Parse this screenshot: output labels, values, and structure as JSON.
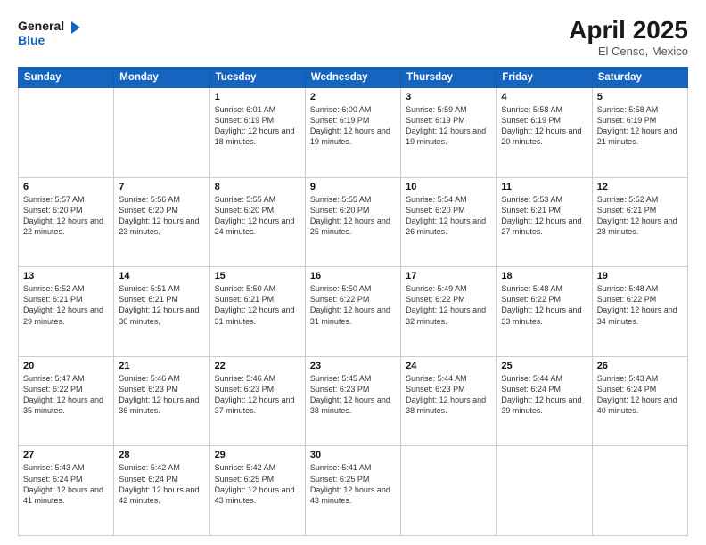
{
  "header": {
    "logo_line1": "General",
    "logo_line2": "Blue",
    "month": "April 2025",
    "location": "El Censo, Mexico"
  },
  "weekdays": [
    "Sunday",
    "Monday",
    "Tuesday",
    "Wednesday",
    "Thursday",
    "Friday",
    "Saturday"
  ],
  "weeks": [
    [
      {
        "day": null,
        "info": null
      },
      {
        "day": null,
        "info": null
      },
      {
        "day": "1",
        "info": "Sunrise: 6:01 AM\nSunset: 6:19 PM\nDaylight: 12 hours and 18 minutes."
      },
      {
        "day": "2",
        "info": "Sunrise: 6:00 AM\nSunset: 6:19 PM\nDaylight: 12 hours and 19 minutes."
      },
      {
        "day": "3",
        "info": "Sunrise: 5:59 AM\nSunset: 6:19 PM\nDaylight: 12 hours and 19 minutes."
      },
      {
        "day": "4",
        "info": "Sunrise: 5:58 AM\nSunset: 6:19 PM\nDaylight: 12 hours and 20 minutes."
      },
      {
        "day": "5",
        "info": "Sunrise: 5:58 AM\nSunset: 6:19 PM\nDaylight: 12 hours and 21 minutes."
      }
    ],
    [
      {
        "day": "6",
        "info": "Sunrise: 5:57 AM\nSunset: 6:20 PM\nDaylight: 12 hours and 22 minutes."
      },
      {
        "day": "7",
        "info": "Sunrise: 5:56 AM\nSunset: 6:20 PM\nDaylight: 12 hours and 23 minutes."
      },
      {
        "day": "8",
        "info": "Sunrise: 5:55 AM\nSunset: 6:20 PM\nDaylight: 12 hours and 24 minutes."
      },
      {
        "day": "9",
        "info": "Sunrise: 5:55 AM\nSunset: 6:20 PM\nDaylight: 12 hours and 25 minutes."
      },
      {
        "day": "10",
        "info": "Sunrise: 5:54 AM\nSunset: 6:20 PM\nDaylight: 12 hours and 26 minutes."
      },
      {
        "day": "11",
        "info": "Sunrise: 5:53 AM\nSunset: 6:21 PM\nDaylight: 12 hours and 27 minutes."
      },
      {
        "day": "12",
        "info": "Sunrise: 5:52 AM\nSunset: 6:21 PM\nDaylight: 12 hours and 28 minutes."
      }
    ],
    [
      {
        "day": "13",
        "info": "Sunrise: 5:52 AM\nSunset: 6:21 PM\nDaylight: 12 hours and 29 minutes."
      },
      {
        "day": "14",
        "info": "Sunrise: 5:51 AM\nSunset: 6:21 PM\nDaylight: 12 hours and 30 minutes."
      },
      {
        "day": "15",
        "info": "Sunrise: 5:50 AM\nSunset: 6:21 PM\nDaylight: 12 hours and 31 minutes."
      },
      {
        "day": "16",
        "info": "Sunrise: 5:50 AM\nSunset: 6:22 PM\nDaylight: 12 hours and 31 minutes."
      },
      {
        "day": "17",
        "info": "Sunrise: 5:49 AM\nSunset: 6:22 PM\nDaylight: 12 hours and 32 minutes."
      },
      {
        "day": "18",
        "info": "Sunrise: 5:48 AM\nSunset: 6:22 PM\nDaylight: 12 hours and 33 minutes."
      },
      {
        "day": "19",
        "info": "Sunrise: 5:48 AM\nSunset: 6:22 PM\nDaylight: 12 hours and 34 minutes."
      }
    ],
    [
      {
        "day": "20",
        "info": "Sunrise: 5:47 AM\nSunset: 6:22 PM\nDaylight: 12 hours and 35 minutes."
      },
      {
        "day": "21",
        "info": "Sunrise: 5:46 AM\nSunset: 6:23 PM\nDaylight: 12 hours and 36 minutes."
      },
      {
        "day": "22",
        "info": "Sunrise: 5:46 AM\nSunset: 6:23 PM\nDaylight: 12 hours and 37 minutes."
      },
      {
        "day": "23",
        "info": "Sunrise: 5:45 AM\nSunset: 6:23 PM\nDaylight: 12 hours and 38 minutes."
      },
      {
        "day": "24",
        "info": "Sunrise: 5:44 AM\nSunset: 6:23 PM\nDaylight: 12 hours and 38 minutes."
      },
      {
        "day": "25",
        "info": "Sunrise: 5:44 AM\nSunset: 6:24 PM\nDaylight: 12 hours and 39 minutes."
      },
      {
        "day": "26",
        "info": "Sunrise: 5:43 AM\nSunset: 6:24 PM\nDaylight: 12 hours and 40 minutes."
      }
    ],
    [
      {
        "day": "27",
        "info": "Sunrise: 5:43 AM\nSunset: 6:24 PM\nDaylight: 12 hours and 41 minutes."
      },
      {
        "day": "28",
        "info": "Sunrise: 5:42 AM\nSunset: 6:24 PM\nDaylight: 12 hours and 42 minutes."
      },
      {
        "day": "29",
        "info": "Sunrise: 5:42 AM\nSunset: 6:25 PM\nDaylight: 12 hours and 43 minutes."
      },
      {
        "day": "30",
        "info": "Sunrise: 5:41 AM\nSunset: 6:25 PM\nDaylight: 12 hours and 43 minutes."
      },
      {
        "day": null,
        "info": null
      },
      {
        "day": null,
        "info": null
      },
      {
        "day": null,
        "info": null
      }
    ]
  ]
}
